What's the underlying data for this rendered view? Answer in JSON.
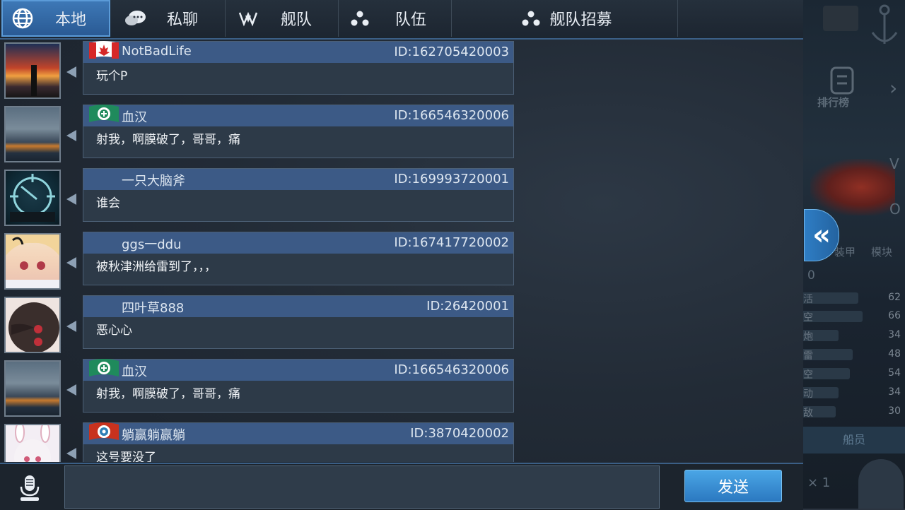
{
  "tabs": [
    {
      "label": "本地",
      "icon": "globe-icon",
      "active": true
    },
    {
      "label": "私聊",
      "icon": "chat-bubbles-icon",
      "active": false
    },
    {
      "label": "舰队",
      "icon": "fleet-emblem-icon",
      "active": false
    },
    {
      "label": "队伍",
      "icon": "team-dots-icon",
      "active": false
    },
    {
      "label": "舰队招募",
      "icon": "team-dots-icon",
      "active": false
    }
  ],
  "messages": [
    {
      "name": "NotBadLife",
      "id": "ID:162705420003",
      "text": "玩个P",
      "flag": "canada"
    },
    {
      "name": "血汉",
      "id": "ID:166546320006",
      "text": "射我，啊膜破了，哥哥，痛",
      "flag": "green-emblem"
    },
    {
      "name": "一只大脑斧",
      "id": "ID:169993720001",
      "text": "谁会",
      "flag": "none"
    },
    {
      "name": "ggs一ddu",
      "id": "ID:167417720002",
      "text": "被秋津洲给雷到了，，，",
      "flag": "none"
    },
    {
      "name": "四叶草888",
      "id": "ID:26420001",
      "text": "恶心心",
      "flag": "none"
    },
    {
      "name": "血汉",
      "id": "ID:166546320006",
      "text": "射我，啊膜破了，哥哥，痛",
      "flag": "green-emblem"
    },
    {
      "name": "躺赢躺赢躺",
      "id": "ID:3870420002",
      "text": "这号要没了",
      "flag": "red-emblem"
    }
  ],
  "input": {
    "value": "",
    "placeholder": ""
  },
  "send_label": "发送",
  "background": {
    "ranking_label": "排行榜",
    "letter_v": "V",
    "letter_o": "O",
    "armor_label": "装甲",
    "module_label": "模块",
    "zero": "0",
    "stats": [
      {
        "label": "活",
        "value": "62"
      },
      {
        "label": "空",
        "value": "66"
      },
      {
        "label": "炮",
        "value": "34"
      },
      {
        "label": "雷",
        "value": "48"
      },
      {
        "label": "空",
        "value": "54"
      },
      {
        "label": "动",
        "value": "34"
      },
      {
        "label": "敌",
        "value": "30"
      }
    ],
    "crew_label": "船员",
    "count_label": "× 1"
  },
  "colors": {
    "accent": "#3d78b6",
    "header": "#3c5a86",
    "send": "#2b78c0"
  }
}
